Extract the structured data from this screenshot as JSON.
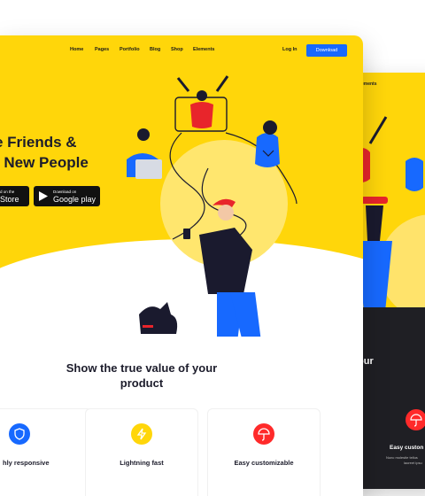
{
  "nav": {
    "items": [
      "Home",
      "Pages",
      "Portfolio",
      "Blog",
      "Shop",
      "Elements"
    ],
    "login_label": "Log In",
    "download_label": "Download"
  },
  "hero": {
    "title_line1": "e Friends &",
    "title_line2": "t New People",
    "appstore": {
      "small": "d on the",
      "big": "Store"
    },
    "googleplay": {
      "small": "Download on",
      "big": "Google play"
    }
  },
  "section": {
    "title_line1": "Show the true value of your",
    "title_line2": "product"
  },
  "features": [
    {
      "label": "hly responsive",
      "icon": "shield-icon"
    },
    {
      "label": "Lightning fast",
      "icon": "lightning-icon"
    },
    {
      "label": "Easy customizable",
      "icon": "umbrella-icon"
    }
  ],
  "back_template": {
    "nav_text": "ements",
    "section_text": "our",
    "feature_label": "Easy custon",
    "feature_desc1": "Nunc molestie tellus",
    "feature_desc2": "laoreet ipsu"
  },
  "colors": {
    "hero_yellow": "#ffd60a",
    "accent_blue": "#1769ff",
    "icon_red": "#ff2a2a",
    "dark": "#1f1f24"
  }
}
